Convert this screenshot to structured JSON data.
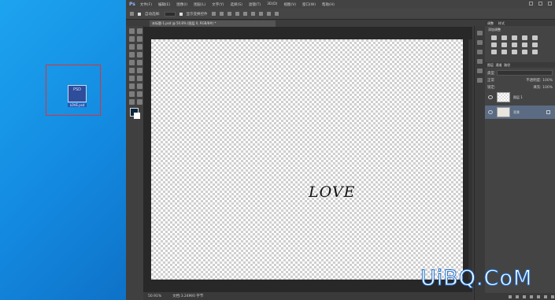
{
  "desktop": {
    "file_icon": {
      "type_label": "PSD",
      "name": "LOVE.psd"
    }
  },
  "photoshop": {
    "logo": "Ps",
    "menu": [
      "文件(F)",
      "编辑(E)",
      "图像(I)",
      "图层(L)",
      "文字(Y)",
      "选择(S)",
      "滤镜(T)",
      "3D(D)",
      "视图(V)",
      "窗口(W)",
      "帮助(H)"
    ],
    "options": {
      "auto_select": "自动选择:",
      "layer_value": "图层",
      "show_transform": "显示变换控件"
    },
    "document_tab": "未标题-1.psd @ 50.8% (图层 0, RGB/8#) *",
    "canvas_text": "LOVE",
    "status": {
      "zoom": "50.91%",
      "doc_size": "文档:3.24M/0 字节"
    },
    "panels": {
      "tabs": [
        "调整",
        "样式"
      ],
      "adjust_title": "添加调整",
      "layers_tabs": [
        "图层",
        "通道",
        "路径"
      ],
      "kind_label": "类型",
      "mode": "正常",
      "opacity": "不透明度: 100%",
      "lock": "锁定:",
      "fill": "填充: 100%",
      "layers": [
        {
          "name": "图层 1",
          "thumb": "transparent",
          "selected": false
        },
        {
          "name": "背景",
          "thumb": "image",
          "selected": true
        }
      ]
    },
    "colors": {
      "selected_layer": "#5b6b83",
      "foreground": "#0b2540",
      "background": "#ffffff"
    }
  },
  "watermark": "UiBQ.CoM"
}
